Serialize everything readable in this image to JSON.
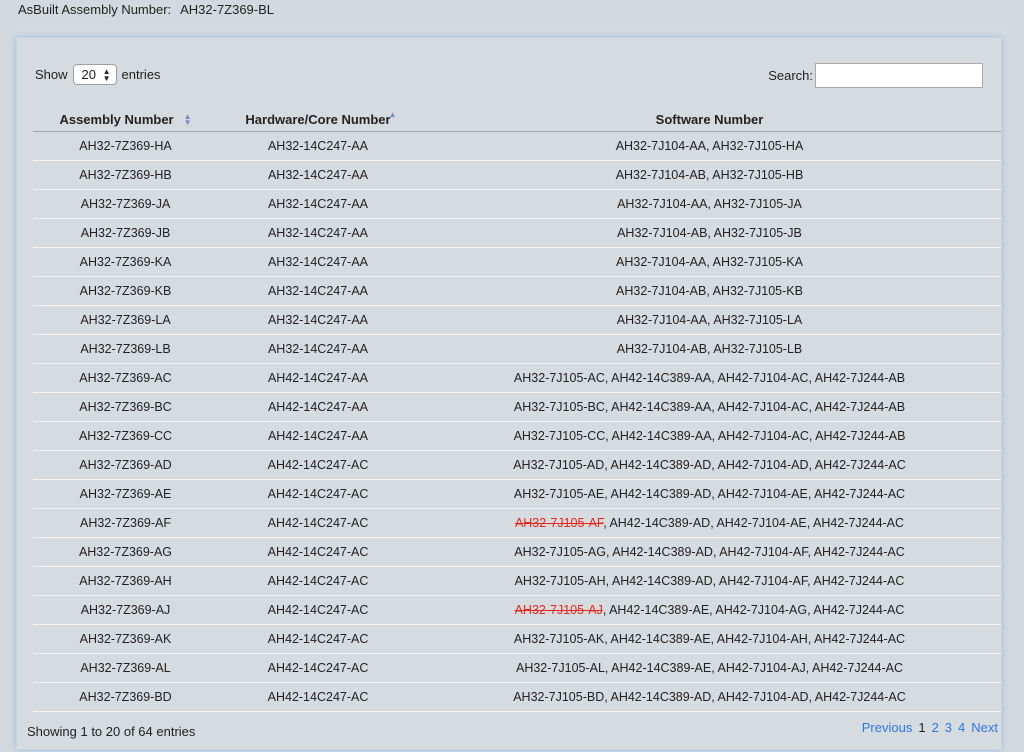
{
  "header": {
    "label": "AsBuilt Assembly Number:",
    "value": "AH32-7Z369-BL"
  },
  "length": {
    "prefix": "Show",
    "selected": "20",
    "suffix": "entries"
  },
  "search": {
    "label": "Search:",
    "value": ""
  },
  "table": {
    "columns": [
      "Assembly Number",
      "Hardware/Core Number",
      "Software Number"
    ],
    "sort": {
      "Assembly Number": "both",
      "Hardware/Core Number": "asc"
    },
    "rows": [
      {
        "assembly": "AH32-7Z369-HA",
        "hardware": "AH32-14C247-AA",
        "software_struck": "",
        "software": "AH32-7J104-AA, AH32-7J105-HA"
      },
      {
        "assembly": "AH32-7Z369-HB",
        "hardware": "AH32-14C247-AA",
        "software_struck": "",
        "software": "AH32-7J104-AB, AH32-7J105-HB"
      },
      {
        "assembly": "AH32-7Z369-JA",
        "hardware": "AH32-14C247-AA",
        "software_struck": "",
        "software": "AH32-7J104-AA, AH32-7J105-JA"
      },
      {
        "assembly": "AH32-7Z369-JB",
        "hardware": "AH32-14C247-AA",
        "software_struck": "",
        "software": "AH32-7J104-AB, AH32-7J105-JB"
      },
      {
        "assembly": "AH32-7Z369-KA",
        "hardware": "AH32-14C247-AA",
        "software_struck": "",
        "software": "AH32-7J104-AA, AH32-7J105-KA"
      },
      {
        "assembly": "AH32-7Z369-KB",
        "hardware": "AH32-14C247-AA",
        "software_struck": "",
        "software": "AH32-7J104-AB, AH32-7J105-KB"
      },
      {
        "assembly": "AH32-7Z369-LA",
        "hardware": "AH32-14C247-AA",
        "software_struck": "",
        "software": "AH32-7J104-AA, AH32-7J105-LA"
      },
      {
        "assembly": "AH32-7Z369-LB",
        "hardware": "AH32-14C247-AA",
        "software_struck": "",
        "software": "AH32-7J104-AB, AH32-7J105-LB"
      },
      {
        "assembly": "AH32-7Z369-AC",
        "hardware": "AH42-14C247-AA",
        "software_struck": "",
        "software": "AH32-7J105-AC, AH42-14C389-AA, AH42-7J104-AC, AH42-7J244-AB"
      },
      {
        "assembly": "AH32-7Z369-BC",
        "hardware": "AH42-14C247-AA",
        "software_struck": "",
        "software": "AH32-7J105-BC, AH42-14C389-AA, AH42-7J104-AC, AH42-7J244-AB"
      },
      {
        "assembly": "AH32-7Z369-CC",
        "hardware": "AH42-14C247-AA",
        "software_struck": "",
        "software": "AH32-7J105-CC, AH42-14C389-AA, AH42-7J104-AC, AH42-7J244-AB"
      },
      {
        "assembly": "AH32-7Z369-AD",
        "hardware": "AH42-14C247-AC",
        "software_struck": "",
        "software": "AH32-7J105-AD, AH42-14C389-AD, AH42-7J104-AD, AH42-7J244-AC"
      },
      {
        "assembly": "AH32-7Z369-AE",
        "hardware": "AH42-14C247-AC",
        "software_struck": "",
        "software": "AH32-7J105-AE, AH42-14C389-AD, AH42-7J104-AE, AH42-7J244-AC"
      },
      {
        "assembly": "AH32-7Z369-AF",
        "hardware": "AH42-14C247-AC",
        "software_struck": "AH32-7J105-AF",
        "software": ", AH42-14C389-AD, AH42-7J104-AE, AH42-7J244-AC"
      },
      {
        "assembly": "AH32-7Z369-AG",
        "hardware": "AH42-14C247-AC",
        "software_struck": "",
        "software": "AH32-7J105-AG, AH42-14C389-AD, AH42-7J104-AF, AH42-7J244-AC"
      },
      {
        "assembly": "AH32-7Z369-AH",
        "hardware": "AH42-14C247-AC",
        "software_struck": "",
        "software": "AH32-7J105-AH, AH42-14C389-AD, AH42-7J104-AF, AH42-7J244-AC"
      },
      {
        "assembly": "AH32-7Z369-AJ",
        "hardware": "AH42-14C247-AC",
        "software_struck": "AH32-7J105-AJ",
        "software": ", AH42-14C389-AE, AH42-7J104-AG, AH42-7J244-AC"
      },
      {
        "assembly": "AH32-7Z369-AK",
        "hardware": "AH42-14C247-AC",
        "software_struck": "",
        "software": "AH32-7J105-AK, AH42-14C389-AE, AH42-7J104-AH, AH42-7J244-AC"
      },
      {
        "assembly": "AH32-7Z369-AL",
        "hardware": "AH42-14C247-AC",
        "software_struck": "",
        "software": "AH32-7J105-AL, AH42-14C389-AE, AH42-7J104-AJ, AH42-7J244-AC"
      },
      {
        "assembly": "AH32-7Z369-BD",
        "hardware": "AH42-14C247-AC",
        "software_struck": "",
        "software": "AH32-7J105-BD, AH42-14C389-AD, AH42-7J104-AD, AH42-7J244-AC"
      }
    ]
  },
  "info": "Showing 1 to 20 of 64 entries",
  "pagination": {
    "previous": "Previous",
    "pages": [
      "1",
      "2",
      "3",
      "4"
    ],
    "current": "1",
    "next": "Next"
  },
  "colors": {
    "link": "#2b78e4",
    "strike": "#e3281d",
    "sort_icon": "#7c84d6"
  }
}
